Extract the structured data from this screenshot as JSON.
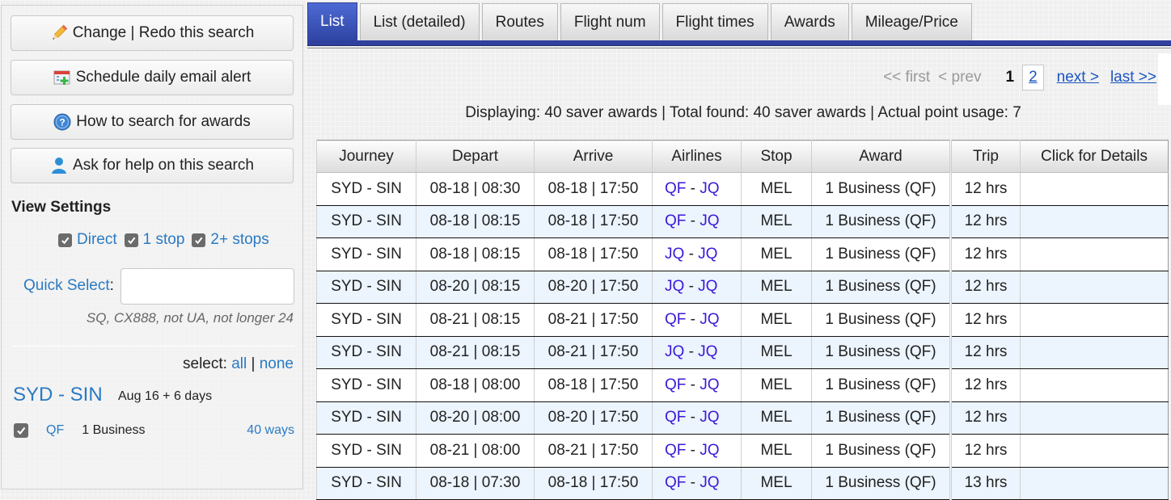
{
  "sidebar": {
    "buttons": [
      {
        "label": "Change | Redo this search",
        "icon": "pencil-icon"
      },
      {
        "label": "Schedule daily email alert",
        "icon": "calendar-add-icon"
      },
      {
        "label": "How to search for awards",
        "icon": "help-icon"
      },
      {
        "label": "Ask for help on this search",
        "icon": "user-icon"
      }
    ],
    "view_settings_title": "View Settings",
    "stops": [
      {
        "label": "Direct",
        "checked": true
      },
      {
        "label": "1 stop",
        "checked": true
      },
      {
        "label": "2+ stops",
        "checked": true
      }
    ],
    "quick_select_label": "Quick Select",
    "quick_select_colon": ":",
    "quick_select_value": "",
    "quick_select_hint": "SQ, CX888, not UA, not longer 24",
    "select_prefix": "select:",
    "select_all": "all",
    "select_sep": "|",
    "select_none": "none",
    "route": {
      "title": "SYD - SIN",
      "dates": "Aug 16 + 6 days",
      "airline": "QF",
      "cabin": "1 Business",
      "ways": "40 ways",
      "checked": true
    }
  },
  "tabs": [
    {
      "label": "List",
      "active": true
    },
    {
      "label": "List (detailed)",
      "active": false
    },
    {
      "label": "Routes",
      "active": false
    },
    {
      "label": "Flight num",
      "active": false
    },
    {
      "label": "Flight times",
      "active": false
    },
    {
      "label": "Awards",
      "active": false
    },
    {
      "label": "Mileage/Price",
      "active": false
    }
  ],
  "pager": {
    "first": "<< first",
    "prev": "< prev",
    "current": "1",
    "page2": "2",
    "next": "next >",
    "last": "last >>"
  },
  "summary": "Displaying: 40 saver awards | Total found: 40 saver awards | Actual point usage: 7",
  "table": {
    "headers": [
      "Journey",
      "Depart",
      "Arrive",
      "Airlines",
      "Stop",
      "Award",
      "Trip",
      "Click for Details"
    ],
    "rows": [
      {
        "journey": "SYD - SIN",
        "depart": "08-18 | 08:30",
        "arrive": "08-18 | 17:50",
        "al1": "QF",
        "sep": "-",
        "al2": "JQ",
        "stop": "MEL",
        "award": "1 Business (QF)",
        "trip": "12 hrs",
        "details": ""
      },
      {
        "journey": "SYD - SIN",
        "depart": "08-18 | 08:15",
        "arrive": "08-18 | 17:50",
        "al1": "QF",
        "sep": "-",
        "al2": "JQ",
        "stop": "MEL",
        "award": "1 Business (QF)",
        "trip": "12 hrs",
        "details": ""
      },
      {
        "journey": "SYD - SIN",
        "depart": "08-18 | 08:15",
        "arrive": "08-18 | 17:50",
        "al1": "JQ",
        "sep": "-",
        "al2": "JQ",
        "stop": "MEL",
        "award": "1 Business (QF)",
        "trip": "12 hrs",
        "details": ""
      },
      {
        "journey": "SYD - SIN",
        "depart": "08-20 | 08:15",
        "arrive": "08-20 | 17:50",
        "al1": "JQ",
        "sep": "-",
        "al2": "JQ",
        "stop": "MEL",
        "award": "1 Business (QF)",
        "trip": "12 hrs",
        "details": ""
      },
      {
        "journey": "SYD - SIN",
        "depart": "08-21 | 08:15",
        "arrive": "08-21 | 17:50",
        "al1": "QF",
        "sep": "-",
        "al2": "JQ",
        "stop": "MEL",
        "award": "1 Business (QF)",
        "trip": "12 hrs",
        "details": ""
      },
      {
        "journey": "SYD - SIN",
        "depart": "08-21 | 08:15",
        "arrive": "08-21 | 17:50",
        "al1": "JQ",
        "sep": "-",
        "al2": "JQ",
        "stop": "MEL",
        "award": "1 Business (QF)",
        "trip": "12 hrs",
        "details": ""
      },
      {
        "journey": "SYD - SIN",
        "depart": "08-18 | 08:00",
        "arrive": "08-18 | 17:50",
        "al1": "QF",
        "sep": "-",
        "al2": "JQ",
        "stop": "MEL",
        "award": "1 Business (QF)",
        "trip": "12 hrs",
        "details": ""
      },
      {
        "journey": "SYD - SIN",
        "depart": "08-20 | 08:00",
        "arrive": "08-20 | 17:50",
        "al1": "QF",
        "sep": "-",
        "al2": "JQ",
        "stop": "MEL",
        "award": "1 Business (QF)",
        "trip": "12 hrs",
        "details": ""
      },
      {
        "journey": "SYD - SIN",
        "depart": "08-21 | 08:00",
        "arrive": "08-21 | 17:50",
        "al1": "QF",
        "sep": "-",
        "al2": "JQ",
        "stop": "MEL",
        "award": "1 Business (QF)",
        "trip": "12 hrs",
        "details": ""
      },
      {
        "journey": "SYD - SIN",
        "depart": "08-18 | 07:30",
        "arrive": "08-18 | 17:50",
        "al1": "QF",
        "sep": "-",
        "al2": "JQ",
        "stop": "MEL",
        "award": "1 Business (QF)",
        "trip": "13 hrs",
        "details": ""
      }
    ]
  },
  "colors": {
    "link": "#2a7ac2",
    "airline_code": "#3b18d8",
    "active_tab": "#2f44a2",
    "row_alt": "#ecf4fd"
  }
}
